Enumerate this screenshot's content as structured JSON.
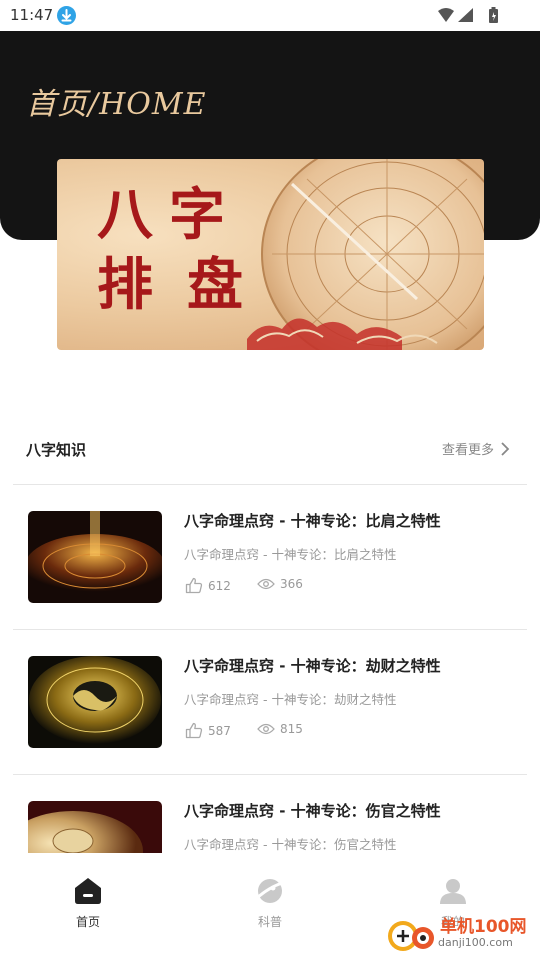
{
  "status_bar": {
    "time": "11:47"
  },
  "header": {
    "title": "首页/HOME"
  },
  "banner": {
    "line1": [
      "八",
      "字"
    ],
    "line2": [
      "排",
      "盘"
    ]
  },
  "section": {
    "title": "八字知识",
    "more_label": "查看更多"
  },
  "articles": [
    {
      "title": "八字命理点窍 - 十神专论：比肩之特性",
      "subtitle": "八字命理点窍 - 十神专论：比肩之特性",
      "likes": "612",
      "views": "366"
    },
    {
      "title": "八字命理点窍 - 十神专论：劫财之特性",
      "subtitle": "八字命理点窍 - 十神专论：劫财之特性",
      "likes": "587",
      "views": "815"
    },
    {
      "title": "八字命理点窍 - 十神专论：伤官之特性",
      "subtitle": "八字命理点窍 - 十神专论：伤官之特性"
    }
  ],
  "nav": [
    {
      "label": "首页",
      "icon": "home-icon",
      "active": true
    },
    {
      "label": "科普",
      "icon": "planet-icon",
      "active": false
    },
    {
      "label": "我的",
      "icon": "user-icon",
      "active": false
    }
  ],
  "watermark": {
    "text": "单机100网",
    "url": "danji100.com"
  },
  "colors": {
    "header_bg": "#141414",
    "title_gold": "#e9c99e",
    "banner_red": "#a6181a",
    "status_blue": "#2fa3e6"
  }
}
